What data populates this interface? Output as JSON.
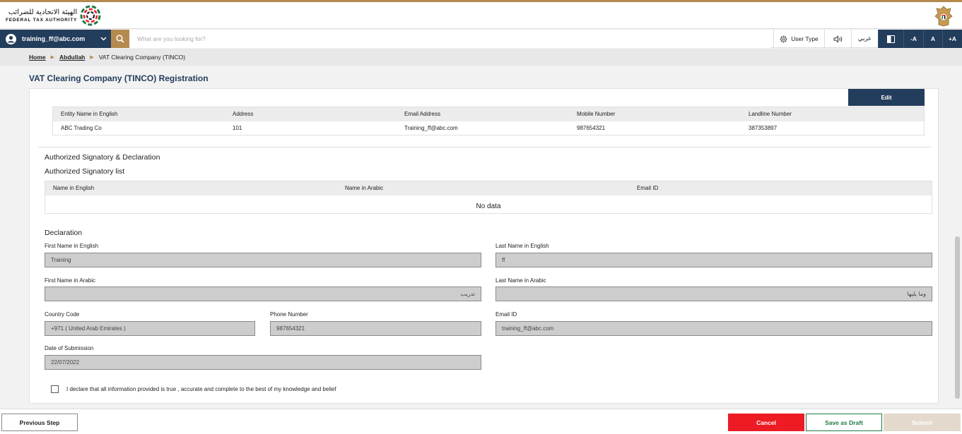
{
  "header": {
    "logo_ar": "الهيئة الاتحادية للضرائب",
    "logo_en": "FEDERAL TAX AUTHORITY"
  },
  "nav": {
    "username": "training_ff@abc.com",
    "search_placeholder": "What are you looking for?",
    "user_type": "User Type",
    "arabic": "عربي",
    "font_decrease": "-A",
    "font_normal": "A",
    "font_increase": "+A"
  },
  "breadcrumb": {
    "home": "Home",
    "parent": "Abdullah",
    "current": "VAT Clearing Company (TINCO)"
  },
  "page_title": "VAT Clearing Company (TINCO) Registration",
  "entity_section": {
    "edit_label": "Edit",
    "columns": [
      "Entity Name in English",
      "Address",
      "Email Address",
      "Mobile Number",
      "Landline Number"
    ],
    "row": [
      "ABC Trading Co",
      "101",
      "Training_ff@abc.com",
      "987654321",
      "387353897"
    ]
  },
  "signatory_section": {
    "title": "Authorized Signatory & Declaration",
    "list_title": "Authorized Signatory list",
    "columns": [
      "Name in English",
      "Name in Arabic",
      "Email ID"
    ],
    "empty_text": "No data"
  },
  "declaration": {
    "title": "Declaration",
    "first_name_en_label": "First Name in English",
    "first_name_en": "Training",
    "last_name_en_label": "Last Name in English",
    "last_name_en": "ff",
    "first_name_ar_label": "First Name in Arabic",
    "first_name_ar": "تدريب",
    "last_name_ar_label": "Last Name in Arabic",
    "last_name_ar": "وما يليها",
    "country_code_label": "Country Code",
    "country_code": "+971 ( United Arab Emirates )",
    "phone_label": "Phone Number",
    "phone": "987654321",
    "email_label": "Email ID",
    "email": "training_ff@abc.com",
    "date_label": "Date of Submission",
    "date": "22/07/2022",
    "checkbox_label": "I declare that all information provided is true , accurate and complete to the best of my knowledge and belief"
  },
  "footer": {
    "previous": "Previous Step",
    "cancel": "Cancel",
    "save_draft": "Save as Draft",
    "submit": "Submit"
  },
  "colors": {
    "navy": "#233d5c",
    "gold": "#b58a4f",
    "cancel_red": "#ed1c24",
    "save_green": "#1e7a46",
    "submit_disabled": "#e3d9cc"
  }
}
